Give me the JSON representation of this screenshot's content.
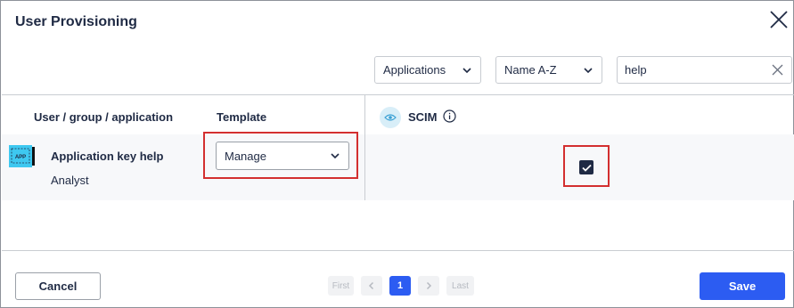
{
  "dialog": {
    "title": "User Provisioning",
    "close_icon": "close-icon"
  },
  "filters": {
    "application_filter": "Applications",
    "sort": "Name A-Z",
    "search_value": "help",
    "clear_icon": "clear-icon"
  },
  "table": {
    "headers": {
      "user_group_app": "User / group / application",
      "template": "Template",
      "scim": "SCIM"
    },
    "rows": [
      {
        "icon": "app-icon",
        "icon_text": "APP",
        "name": "Application key help",
        "role": "Analyst",
        "template": "Manage",
        "scim_checked": true
      }
    ]
  },
  "pagination": {
    "first": "First",
    "current_page": "1",
    "last": "Last"
  },
  "footer": {
    "cancel_label": "Cancel",
    "save_label": "Save"
  },
  "colors": {
    "primary": "#2c5cf2",
    "highlight": "#d32f2f",
    "text": "#1f2a44",
    "checkbox": "#1f2a44"
  }
}
